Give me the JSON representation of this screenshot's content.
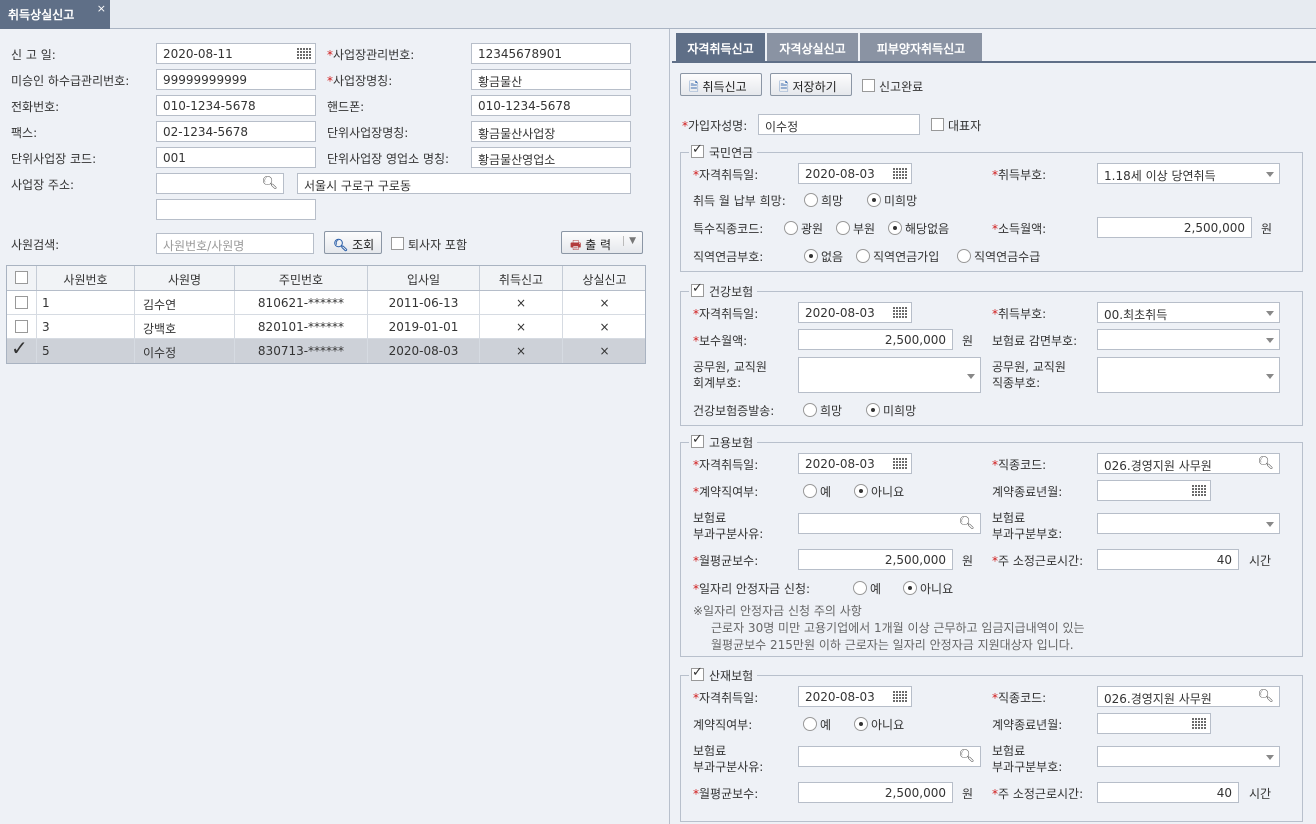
{
  "doc_tab": {
    "title": "취득상실신고",
    "close": "×"
  },
  "left": {
    "labels": {
      "report_date": "신 고 일:",
      "sub_contract_no": "미승인 하수급관리번호:",
      "phone": "전화번호:",
      "fax": "팩스:",
      "unit_code": "단위사업장 코드:",
      "address": "사업장 주소:",
      "biz_mgmt_no": "사업장관리번호:",
      "biz_name": "사업장명칭:",
      "mobile": "핸드폰:",
      "unit_name": "단위사업장명칭:",
      "unit_office_name": "단위사업장 영업소 명칭:",
      "emp_search": "사원검색:"
    },
    "values": {
      "report_date": "2020-08-11",
      "sub_contract_no": "99999999999",
      "phone": "010-1234-5678",
      "fax": "02-1234-5678",
      "unit_code": "001",
      "address_detail": "서울시 구로구 구로동",
      "biz_mgmt_no": "12345678901",
      "biz_name": "황금물산",
      "mobile": "010-1234-5678",
      "unit_name": "황금물산사업장",
      "unit_office_name": "황금물산영업소"
    },
    "search_placeholder": "사원번호/사원명",
    "search_button": "조회",
    "retired_label": "퇴사자 포함",
    "print_button": "출 력",
    "grid": {
      "headers": [
        "사원번호",
        "사원명",
        "주민번호",
        "입사일",
        "취득신고",
        "상실신고"
      ],
      "rows": [
        {
          "no": "1",
          "name": "김수연",
          "rrn": "810621-******",
          "join": "2011-06-13",
          "acq": "×",
          "loss": "×",
          "checked": false
        },
        {
          "no": "3",
          "name": "강백호",
          "rrn": "820101-******",
          "join": "2019-01-01",
          "acq": "×",
          "loss": "×",
          "checked": false
        },
        {
          "no": "5",
          "name": "이수정",
          "rrn": "830713-******",
          "join": "2020-08-03",
          "acq": "×",
          "loss": "×",
          "checked": true
        }
      ]
    }
  },
  "right": {
    "tabs": [
      "자격취득신고",
      "자격상실신고",
      "피부양자취득신고"
    ],
    "toolbar": {
      "acq_report": "취득신고",
      "save": "저장하기",
      "done": "신고완료"
    },
    "subscriber_label": "가입자성명:",
    "subscriber_value": "이수정",
    "representative": "대표자",
    "pension": {
      "title": "국민연금",
      "acq_date_label": "자격취득일:",
      "acq_date": "2020-08-03",
      "acq_code_label": "취득부호:",
      "acq_code": "1.18세 이상 당연취득",
      "pay_hope_label": "취득 월 납부 희망:",
      "hope": "희망",
      "no_hope": "미희망",
      "special_label": "특수직종코드:",
      "miner": "광원",
      "sailor": "부원",
      "none": "해당없음",
      "income_label": "소득월액:",
      "income": "2,500,000",
      "won": "원",
      "occ_label": "직역연금부호:",
      "occ_none": "없음",
      "occ_join": "직역연금가입",
      "occ_receive": "직역연금수급"
    },
    "health": {
      "title": "건강보험",
      "acq_date_label": "자격취득일:",
      "acq_date": "2020-08-03",
      "acq_code_label": "취득부호:",
      "acq_code": "00.최초취득",
      "wage_label": "보수월액:",
      "wage": "2,500,000",
      "won": "원",
      "reduce_label": "보험료 감면부호:",
      "acct_label1": "공무원, 교직원",
      "acct_label2": "회계부호:",
      "job_label1": "공무원, 교직원",
      "job_label2": "직종부호:",
      "card_label": "건강보험증발송:",
      "hope": "희망",
      "no_hope": "미희망"
    },
    "employment": {
      "title": "고용보험",
      "acq_date_label": "자격취득일:",
      "acq_date": "2020-08-03",
      "job_code_label": "직종코드:",
      "job_code": "026.경영지원 사무원",
      "contract_label": "계약직여부:",
      "yes": "예",
      "no": "아니요",
      "end_label": "계약종료년월:",
      "reason_label1": "보험료",
      "reason_label2": "부과구분사유:",
      "cat_label1": "보험료",
      "cat_label2": "부과구분부호:",
      "avg_label": "월평균보수:",
      "avg": "2,500,000",
      "won": "원",
      "hours_label": "주 소정근로시간:",
      "hours": "40",
      "hours_unit": "시간",
      "stab_label": "일자리 안정자금 신청:",
      "note1": "※일자리 안정자금 신청 주의 사항",
      "note2": "근로자 30명 미만 고용기업에서 1개월 이상 근무하고 임금지급내역이 있는",
      "note3": "월평균보수 215만원 이하 근로자는 일자리 안정자금 지원대상자 입니다."
    },
    "industrial": {
      "title": "산재보험",
      "acq_date_label": "자격취득일:",
      "acq_date": "2020-08-03",
      "job_code_label": "직종코드:",
      "job_code": "026.경영지원 사무원",
      "contract_label": "계약직여부:",
      "yes": "예",
      "no": "아니요",
      "end_label": "계약종료년월:",
      "reason_label1": "보험료",
      "reason_label2": "부과구분사유:",
      "cat_label1": "보험료",
      "cat_label2": "부과구분부호:",
      "avg_label": "월평균보수:",
      "avg": "2,500,000",
      "won": "원",
      "hours_label": "주 소정근로시간:",
      "hours": "40",
      "hours_unit": "시간"
    }
  }
}
